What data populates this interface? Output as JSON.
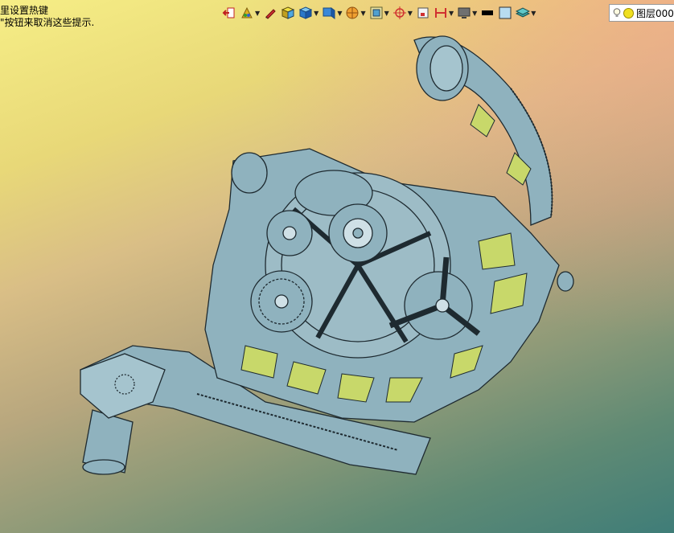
{
  "hint": {
    "line1": "里设置热键",
    "line2": "\"按钮来取消这些提示."
  },
  "toolbar": {
    "items": [
      {
        "icon": "exit-sketch-icon",
        "caret": false
      },
      {
        "icon": "palette-icon",
        "caret": true
      },
      {
        "icon": "pencil-icon",
        "caret": false
      },
      {
        "icon": "shaded-cube-icon",
        "caret": false
      },
      {
        "icon": "blue-cube-icon",
        "caret": true
      },
      {
        "icon": "view-cube-icon",
        "caret": true
      },
      {
        "icon": "orange-sphere-icon",
        "caret": true
      },
      {
        "icon": "view-orient-icon",
        "caret": true
      },
      {
        "icon": "rotate-axis-icon",
        "caret": true
      },
      {
        "icon": "square-icon",
        "caret": false
      },
      {
        "icon": "section-icon",
        "caret": true
      },
      {
        "icon": "monitor-icon",
        "caret": true
      },
      {
        "icon": "black-rect-icon",
        "caret": false
      },
      {
        "icon": "light-blue-square-icon",
        "caret": false
      },
      {
        "icon": "layers-icon",
        "caret": true
      }
    ]
  },
  "layer": {
    "name": "图层000"
  },
  "colors": {
    "part_fill": "#8fb2be",
    "part_edge": "#1e2a30",
    "gradient_top": "#f6ee86",
    "gradient_bottom": "#3f7d78"
  }
}
